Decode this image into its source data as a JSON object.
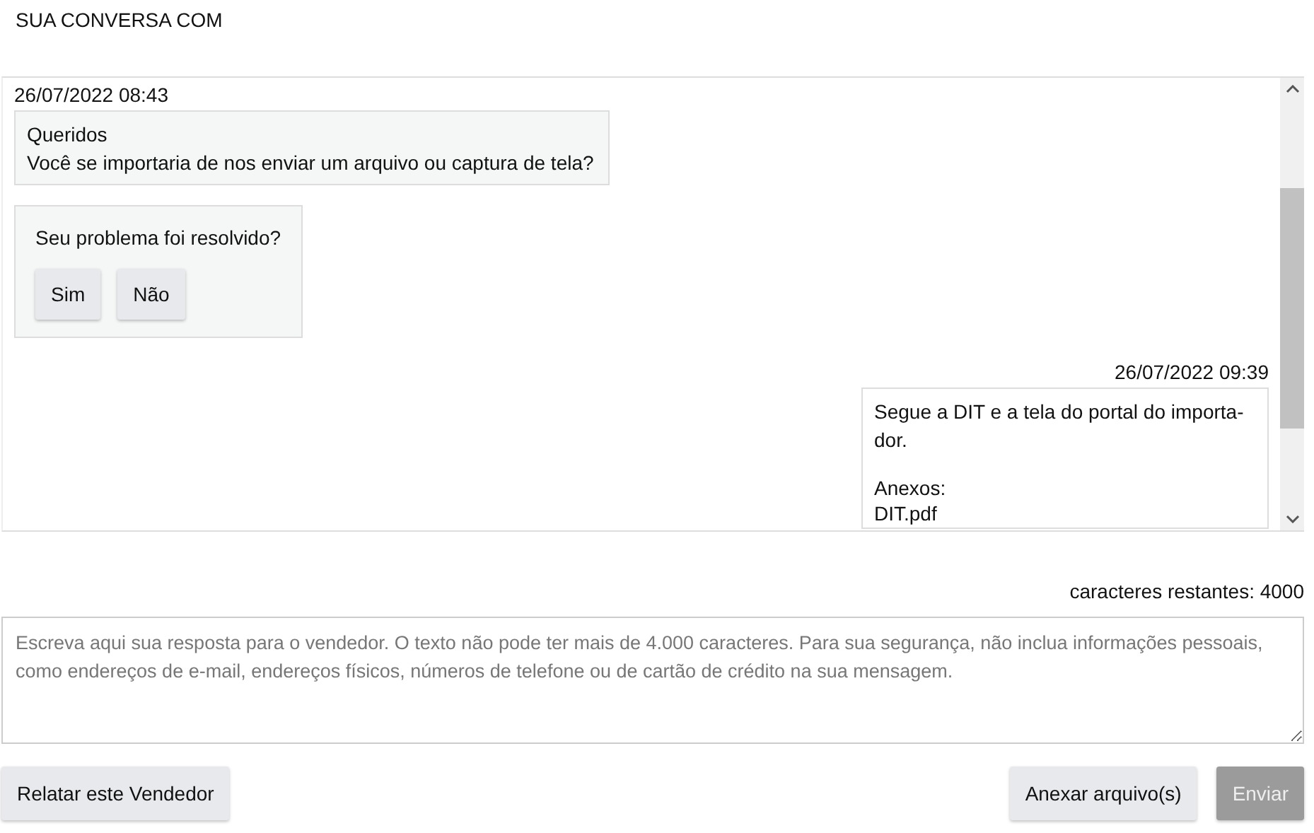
{
  "header": {
    "title": "SUA CONVERSA COM"
  },
  "messages": [
    {
      "kind": "received",
      "timestamp": "26/07/2022 08:43",
      "lines": [
        "Queridos",
        "Você se importaria de nos enviar um arquivo ou captura de tela?"
      ]
    },
    {
      "kind": "survey",
      "question": "Seu problema foi resolvido?",
      "buttons": [
        "Sim",
        "Não"
      ]
    },
    {
      "kind": "sent",
      "timestamp": "26/07/2022 09:39",
      "lines": [
        "Segue a DIT e a tela do portal do importa-",
        "dor."
      ],
      "attachments_label": "Anexos:",
      "attachments": [
        "DIT.pdf"
      ]
    }
  ],
  "counter": "caracteres restantes: 4000",
  "reply": {
    "placeholder": "Escreva aqui sua resposta para o vendedor. O texto não pode ter mais de 4.000 caracteres. Para sua segurança, não inclua informações pessoais, como endereços de e-mail, endereços físicos, números de telefone ou de cartão de crédito na sua mensagem."
  },
  "actions": [
    {
      "kind": "report",
      "label": "Relatar este Vendedor",
      "disabled": false
    },
    {
      "kind": "attach",
      "label": "Anexar arquivo(s)",
      "disabled": false
    },
    {
      "kind": "send",
      "label": "Enviar",
      "disabled": true
    }
  ]
}
